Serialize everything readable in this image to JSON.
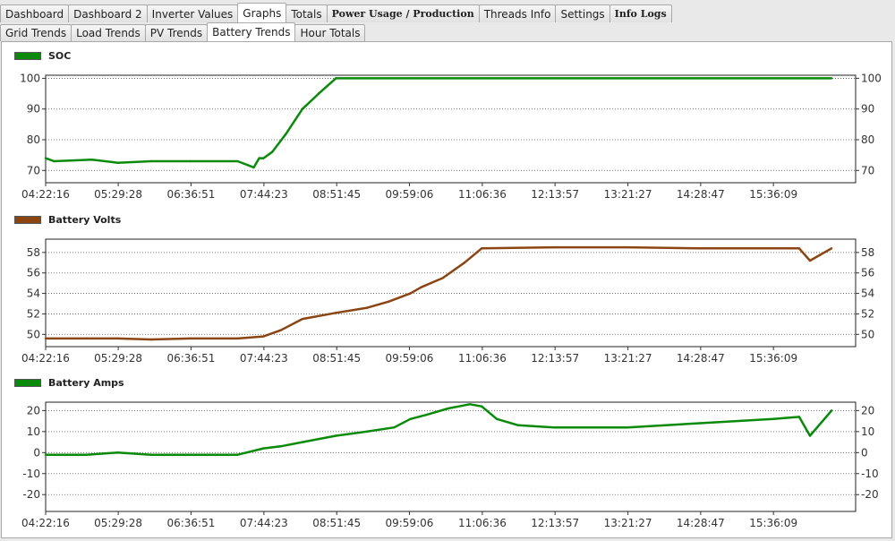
{
  "top_tabs": [
    "Dashboard",
    "Dashboard 2",
    "Inverter Values",
    "Graphs",
    "Totals",
    "Power Usage / Production",
    "Threads Info",
    "Settings",
    "Info Logs"
  ],
  "top_active": "Graphs",
  "sub_tabs": [
    "Grid Trends",
    "Load Trends",
    "PV Trends",
    "Battery Trends",
    "Hour Totals"
  ],
  "sub_active": "Battery Trends",
  "colors": {
    "soc": "#0a8a0a",
    "volts": "#8b4513",
    "amps": "#0a8a0a"
  },
  "x_ticks": [
    "04:22:16",
    "05:29:28",
    "06:36:51",
    "07:44:23",
    "08:51:45",
    "09:59:06",
    "11:06:36",
    "12:13:57",
    "13:21:27",
    "14:28:47",
    "15:36:09"
  ],
  "chart_data": [
    {
      "type": "line",
      "name": "SOC",
      "legend": "SOC",
      "yticks": [
        70,
        80,
        90,
        100
      ],
      "ylim": [
        66,
        101
      ],
      "x": [
        "04:22:16",
        "04:30",
        "05:05",
        "05:29",
        "06:00",
        "06:36",
        "07:20",
        "07:35",
        "07:40",
        "07:44",
        "07:52",
        "08:05",
        "08:20",
        "08:35",
        "08:51",
        "09:59",
        "11:06",
        "12:13",
        "13:21",
        "14:28",
        "15:36",
        "16:30"
      ],
      "values": [
        74,
        73,
        73.5,
        72.5,
        73,
        73,
        73,
        71,
        74,
        74,
        76,
        82,
        90,
        95,
        100,
        100,
        100,
        100,
        100,
        100,
        100,
        100
      ]
    },
    {
      "type": "line",
      "name": "Battery Volts",
      "legend": "Battery Volts",
      "yticks": [
        50,
        52,
        54,
        56,
        58
      ],
      "ylim": [
        48.8,
        59.3
      ],
      "x": [
        "04:22:16",
        "05:00",
        "05:29",
        "06:00",
        "06:36",
        "07:20",
        "07:44",
        "08:00",
        "08:20",
        "08:51",
        "09:20",
        "09:40",
        "10:00",
        "10:10",
        "10:30",
        "10:50",
        "11:06",
        "12:13",
        "13:21",
        "14:28",
        "15:36",
        "16:00",
        "16:10",
        "16:30"
      ],
      "values": [
        49.6,
        49.6,
        49.6,
        49.5,
        49.6,
        49.6,
        49.8,
        50.4,
        51.5,
        52.1,
        52.6,
        53.2,
        54,
        54.6,
        55.5,
        57,
        58.4,
        58.5,
        58.5,
        58.4,
        58.4,
        58.4,
        57.2,
        58.4
      ]
    },
    {
      "type": "line",
      "name": "Battery Amps",
      "legend": "Battery Amps",
      "yticks": [
        -20,
        -10,
        0,
        10,
        20
      ],
      "ylim": [
        -28,
        24
      ],
      "x": [
        "04:22:16",
        "05:00",
        "05:29",
        "06:00",
        "06:36",
        "07:20",
        "07:44",
        "08:00",
        "08:20",
        "08:51",
        "09:20",
        "09:45",
        "10:00",
        "10:15",
        "10:35",
        "10:55",
        "11:06",
        "11:20",
        "11:40",
        "12:13",
        "13:21",
        "14:28",
        "15:36",
        "16:00",
        "16:10",
        "16:30"
      ],
      "values": [
        -1,
        -1,
        0,
        -1,
        -1,
        -1,
        2,
        3,
        5,
        8,
        10,
        12,
        16,
        18,
        21,
        23,
        22,
        16,
        13,
        12,
        12,
        14,
        16,
        17,
        8,
        20
      ]
    }
  ]
}
